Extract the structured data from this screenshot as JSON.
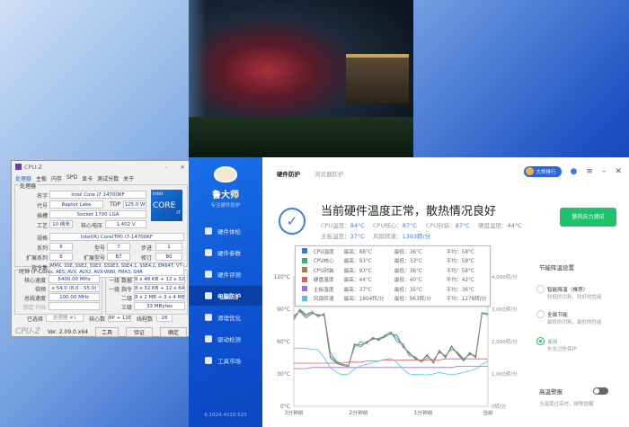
{
  "cpuz": {
    "title": "CPU-Z",
    "tabs": [
      "处理器",
      "主板",
      "内存",
      "SPD",
      "显卡",
      "测试分数",
      "关于"
    ],
    "group_processor": "处理器",
    "fields": [
      {
        "l": "名字",
        "v": "Intel Core i7 14700KF"
      },
      {
        "l": "代号",
        "v": "Raptor Lake"
      },
      {
        "l": "插槽",
        "v": "Socket 1700 LGA"
      },
      {
        "l": "工艺",
        "v": "10 纳米"
      },
      {
        "l": "规格",
        "v": "Intel(R) Core(TM) i7-14700KF"
      },
      {
        "l": "系列",
        "v": "6"
      },
      {
        "l": "扩展系列",
        "v": "6"
      },
      {
        "l": "指令集",
        "v": "MMX, SSE, SSE2, SSE3, SSSE3, SSE4.1, SSE4.2, EM64T, VT-x, AES, AVX, AVX2, AVX-VNNI, FMA3, SHA"
      }
    ],
    "tdp_label": "TDP",
    "tdp": "125.0 W",
    "voltage_label": "核心电压",
    "voltage": "1.402 V",
    "model_label": "型号",
    "model": "7",
    "stepping_label": "步进",
    "stepping": "1",
    "ext_model_label": "扩展型号",
    "ext_model": "B7",
    "revision_label": "修订",
    "revision": "B0",
    "intel_badge": {
      "brand": "intel",
      "core": "CORE",
      "tier": "i7"
    },
    "clocks_title": "时钟 (P-Core #0)",
    "clocks": [
      {
        "l": "核心速度",
        "v": "5400.00 MHz"
      },
      {
        "l": "倍频",
        "v": "x 54.0 (8.0 - 55.0)"
      },
      {
        "l": "总线速度",
        "v": "100.00 MHz"
      },
      {
        "l": "额定 FSB",
        "v": ""
      }
    ],
    "cache_title": "缓存",
    "cache": [
      {
        "l": "一级 数据",
        "v": "8 x 48 KB + 12 x 32 KB"
      },
      {
        "l": "一级 指令",
        "v": "8 x 32 KB + 12 x 64 KB"
      },
      {
        "l": "二级",
        "v": "8 x 2 MB + 3 x 4 MB"
      },
      {
        "l": "三级",
        "v": "33 MBytes"
      }
    ],
    "selected_label": "已选择",
    "selected": "处理器 #1",
    "cores_label": "核心数",
    "cores": "8P + 12E",
    "threads_label": "线程数",
    "threads": "28",
    "footer_logo": "CPU-Z",
    "version": "Ver. 2.09.0.x64",
    "tools": "工具",
    "validate": "验证",
    "ok": "确定"
  },
  "lds": {
    "brand": "鲁大师",
    "slogan": "专注硬件防护",
    "nav": [
      "硬件体检",
      "硬件参数",
      "硬件评测",
      "电脑防护",
      "清理优化",
      "驱动检测",
      "工具市场"
    ],
    "active_nav": 3,
    "version": "6.1024.4010.523",
    "tabs": [
      "硬件防护",
      "浏览器防护"
    ],
    "rank": "大师排行",
    "status_title": "当前硬件温度正常，散热情况良好",
    "stats": [
      {
        "l": "CPU温度：",
        "v": "84°C"
      },
      {
        "l": "CPU核心：",
        "v": "87°C"
      },
      {
        "l": "CPU封装：",
        "v": "87°C"
      },
      {
        "l": "硬盘温度：",
        "v": "44°C"
      },
      {
        "l": "主板温度：",
        "v": "37°C"
      },
      {
        "l": "风扇转速：",
        "v": "1393转/分"
      }
    ],
    "stress_btn": "散热压力测试",
    "settings_title": "节能降温设置",
    "options": [
      {
        "t": "智能降温（推荐）",
        "s": "较低的功耗、较好的性能",
        "on": false
      },
      {
        "t": "全面节能",
        "s": "最低的功耗、最低的性能",
        "on": false
      },
      {
        "t": "关闭",
        "s": "失去过热保护",
        "on": true
      }
    ],
    "alert_title": "高温警报",
    "alert_sub": "当温度过高时，报警提醒"
  },
  "chart_data": {
    "type": "line",
    "x_labels": [
      "3分钟前",
      "2分钟前",
      "1分钟前",
      "当前"
    ],
    "y_left_ticks": [
      "0°C",
      "30°C",
      "60°C",
      "90°C",
      "120°C"
    ],
    "y_left_range": [
      0,
      120
    ],
    "y_right_ticks": [
      "0转/分",
      "1,000转/分",
      "2,000转/分",
      "3,000转/分",
      "4,000转/分"
    ],
    "y_right_range": [
      0,
      4000
    ],
    "legend": [
      {
        "name": "CPU温度",
        "max": "最高：88°C",
        "min": "最低：36°C",
        "avg": "平均：58°C",
        "color": "#2f7be0"
      },
      {
        "name": "CPU核心",
        "max": "最高：93°C",
        "min": "最低：33°C",
        "avg": "平均：58°C",
        "color": "#2bb673"
      },
      {
        "name": "CPU封装",
        "max": "最高：93°C",
        "min": "最低：36°C",
        "avg": "平均：58°C",
        "color": "#b07a56"
      },
      {
        "name": "硬盘温度",
        "max": "最高：44°C",
        "min": "最低：40°C",
        "avg": "平均：42°C",
        "color": "#e25b5b"
      },
      {
        "name": "主板温度",
        "max": "最高：37°C",
        "min": "最低：35°C",
        "avg": "平均：36°C",
        "color": "#9b6ee8"
      },
      {
        "name": "风扇转速",
        "max": "最高：1804转/分",
        "min": "最低：963转/分",
        "avg": "平均：1278转/分",
        "color": "#4fc3e8"
      }
    ],
    "series": [
      {
        "name": "CPU温度",
        "axis": "left",
        "values": [
          84,
          88,
          82,
          86,
          85,
          84,
          45,
          40,
          38,
          37,
          58,
          55,
          60,
          62,
          63,
          65,
          67,
          66,
          55,
          50,
          44,
          42,
          48,
          40,
          52,
          45,
          56,
          48,
          42,
          50,
          45,
          86,
          85
        ]
      },
      {
        "name": "CPU核心",
        "axis": "left",
        "values": [
          80,
          90,
          85,
          88,
          83,
          86,
          50,
          42,
          39,
          38,
          55,
          60,
          58,
          64,
          61,
          66,
          69,
          60,
          58,
          47,
          46,
          41,
          45,
          43,
          50,
          47,
          53,
          50,
          44,
          48,
          47,
          87,
          86
        ]
      },
      {
        "name": "CPU封装",
        "axis": "left",
        "values": [
          82,
          89,
          84,
          87,
          84,
          85,
          47,
          41,
          38,
          37,
          57,
          57,
          59,
          63,
          62,
          64,
          68,
          63,
          56,
          49,
          45,
          42,
          47,
          41,
          51,
          46,
          55,
          49,
          43,
          49,
          46,
          86,
          85
        ]
      },
      {
        "name": "硬盘温度",
        "axis": "left",
        "values": [
          40,
          40,
          40,
          40,
          40,
          40,
          40,
          40,
          40,
          41,
          41,
          41,
          42,
          42,
          42,
          43,
          43,
          43,
          43,
          43,
          43,
          43,
          43,
          43,
          43,
          44,
          44,
          44,
          44,
          44,
          44,
          44,
          44
        ]
      },
      {
        "name": "主板温度",
        "axis": "left",
        "values": [
          35,
          35,
          35,
          36,
          36,
          36,
          36,
          36,
          36,
          36,
          36,
          36,
          36,
          36,
          36,
          36,
          36,
          36,
          36,
          36,
          36,
          36,
          36,
          36,
          36,
          36,
          36,
          37,
          37,
          37,
          37,
          37,
          37
        ]
      },
      {
        "name": "风扇转速",
        "axis": "right",
        "values": [
          1800,
          1800,
          1790,
          1760,
          1750,
          1500,
          1200,
          1050,
          980,
          1000,
          1150,
          1250,
          1300,
          1350,
          1400,
          1450,
          1480,
          1350,
          1150,
          1000,
          980,
          980,
          970,
          1000,
          1050,
          1000,
          990,
          1000,
          1050,
          1100,
          1150,
          1300,
          1400
        ]
      }
    ]
  }
}
